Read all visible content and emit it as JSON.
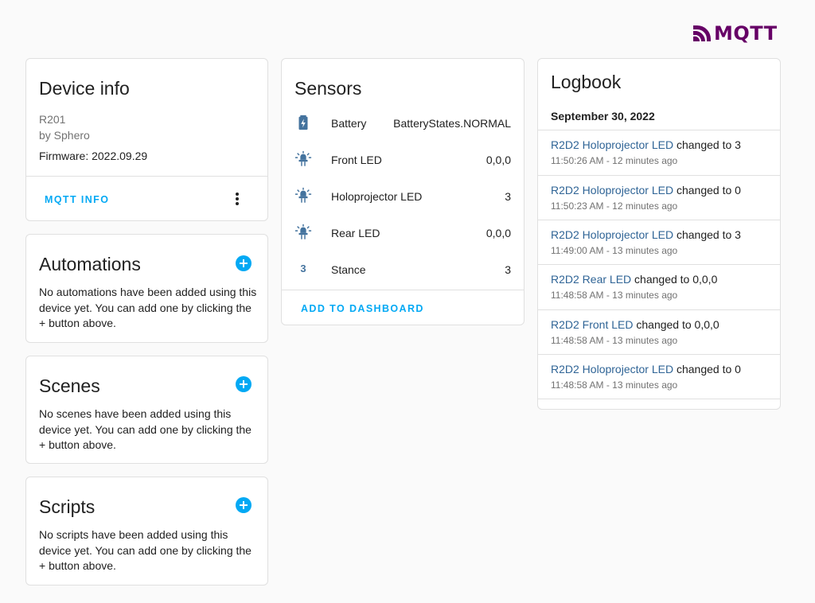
{
  "logo": {
    "text": "MQTT"
  },
  "device_info": {
    "title": "Device info",
    "model": "R201",
    "manufacturer": "by Sphero",
    "firmware": "Firmware: 2022.09.29",
    "mqtt_info_label": "MQTT INFO"
  },
  "automations": {
    "title": "Automations",
    "description": "No automations have been added using this device yet. You can add one by clicking the + button above."
  },
  "scenes": {
    "title": "Scenes",
    "description": "No scenes have been added using this device yet. You can add one by clicking the + button above."
  },
  "scripts": {
    "title": "Scripts",
    "description": "No scripts have been added using this device yet. You can add one by clicking the + button above."
  },
  "sensors": {
    "title": "Sensors",
    "items": [
      {
        "icon": "battery-charging-icon",
        "name": "Battery",
        "value": "BatteryStates.NORMAL"
      },
      {
        "icon": "led-icon",
        "name": "Front LED",
        "value": "0,0,0"
      },
      {
        "icon": "led-icon",
        "name": "Holoprojector LED",
        "value": "3"
      },
      {
        "icon": "led-icon",
        "name": "Rear LED",
        "value": "0,0,0"
      },
      {
        "icon": "numeric-3-icon",
        "icon_text": "3",
        "name": "Stance",
        "value": "3"
      }
    ],
    "add_to_dashboard_label": "ADD TO DASHBOARD"
  },
  "logbook": {
    "title": "Logbook",
    "date": "September 30, 2022",
    "entries": [
      {
        "entity": "R2D2 Holoprojector LED",
        "action": " changed to 3",
        "time": "11:50:26 AM - 12 minutes ago"
      },
      {
        "entity": "R2D2 Holoprojector LED",
        "action": " changed to 0",
        "time": "11:50:23 AM - 12 minutes ago"
      },
      {
        "entity": "R2D2 Holoprojector LED",
        "action": " changed to 3",
        "time": "11:49:00 AM - 13 minutes ago"
      },
      {
        "entity": "R2D2 Rear LED",
        "action": " changed to 0,0,0",
        "time": "11:48:58 AM - 13 minutes ago"
      },
      {
        "entity": "R2D2 Front LED",
        "action": " changed to 0,0,0",
        "time": "11:48:58 AM - 13 minutes ago"
      },
      {
        "entity": "R2D2 Holoprojector LED",
        "action": " changed to 0",
        "time": "11:48:58 AM - 13 minutes ago"
      }
    ]
  },
  "colors": {
    "accent": "#03a9f4",
    "link": "#2f6496",
    "icon": "#44739e",
    "logo": "#660066"
  }
}
